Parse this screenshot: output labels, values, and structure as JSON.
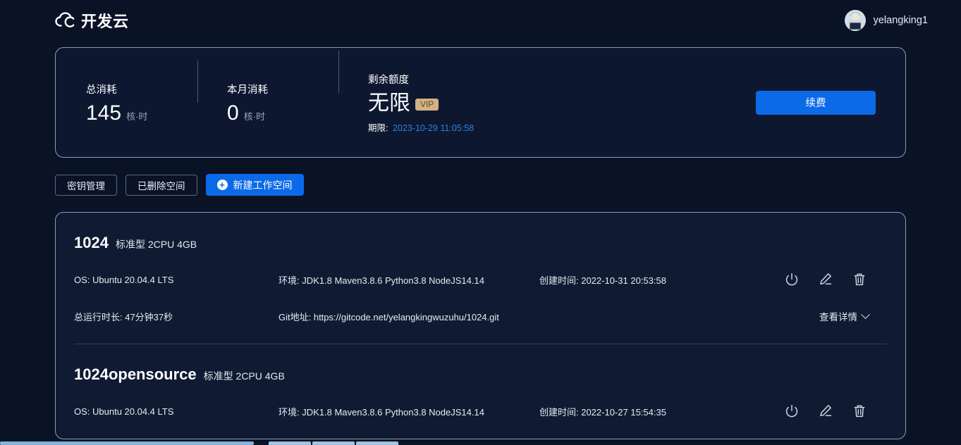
{
  "header": {
    "brand_icon": "cloud-icon",
    "brand_text": "开发云",
    "username": "yelangking1",
    "avatar_icon": "user-avatar"
  },
  "stats": {
    "items": [
      {
        "label": "总消耗",
        "value": "145",
        "unit": "核·时"
      },
      {
        "label": "本月消耗",
        "value": "0",
        "unit": "核·时"
      }
    ],
    "quota": {
      "label": "剩余额度",
      "value": "无限",
      "badge": "VIP",
      "expiry_label": "期限:",
      "expiry_date": "2023-10-29 11:05:58"
    },
    "renew_label": "续费"
  },
  "toolbar": {
    "key_manage_label": "密钥管理",
    "deleted_spaces_label": "已删除空间",
    "new_workspace_label": "新建工作空间",
    "new_workspace_icon": "plus-circle-icon"
  },
  "workspaces": [
    {
      "name": "1024",
      "spec": "标准型 2CPU 4GB",
      "os": "OS: Ubuntu 20.04.4 LTS",
      "env": "环境: JDK1.8 Maven3.8.6 Python3.8 NodeJS14.14",
      "created": "创建时间: 2022-10-31 20:53:58",
      "runtime": "总运行时长: 47分钟37秒",
      "git": "Git地址: https://gitcode.net/yelangkingwuzuhu/1024.git",
      "detail_label": "查看详情"
    },
    {
      "name": "1024opensource",
      "spec": "标准型 2CPU 4GB",
      "os": "OS: Ubuntu 20.04.4 LTS",
      "env": "环境: JDK1.8 Maven3.8.6 Python3.8 NodeJS14.14",
      "created": "创建时间: 2022-10-27 15:54:35",
      "runtime": "",
      "git": "",
      "detail_label": ""
    }
  ],
  "icons": {
    "power": "power-icon",
    "edit": "edit-pencil-icon",
    "delete": "trash-icon",
    "chevron": "chevron-down-icon"
  },
  "colors": {
    "page_bg": "#0a1226",
    "card_bg": "#101b33",
    "accent": "#0b6ae8",
    "link": "#2f82d8",
    "badge": "#d3b183",
    "border": "#8e9cb8"
  }
}
